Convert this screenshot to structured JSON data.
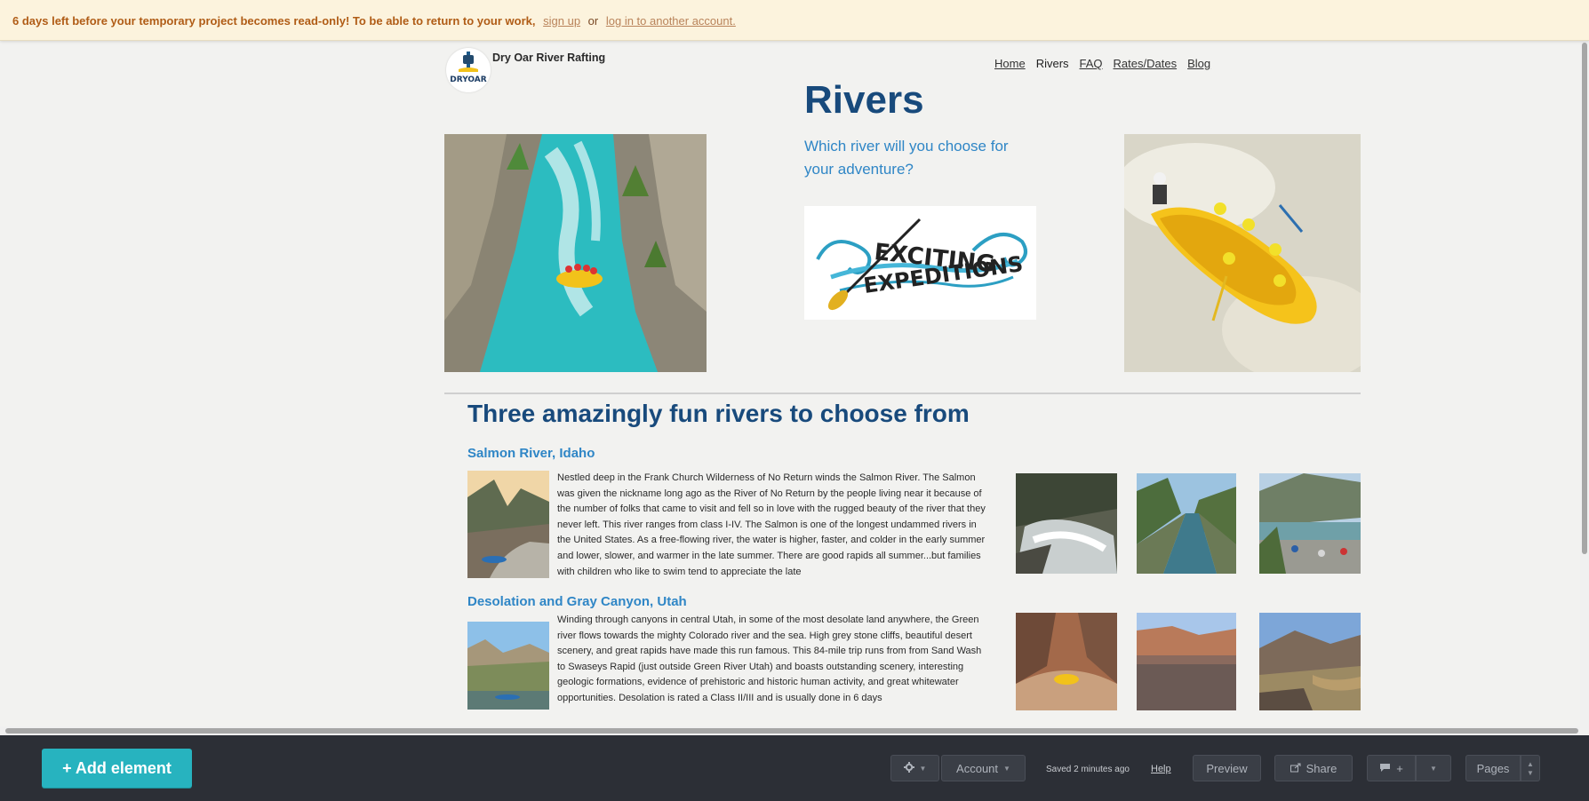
{
  "banner": {
    "message": "6 days left before your temporary project becomes read-only! To be able to return to your work,",
    "signup_link": "sign up",
    "or_text": "or",
    "login_link": "log in to another account."
  },
  "site": {
    "name": "Dry Oar River Rafting",
    "logo_text": "DRYOAR"
  },
  "nav": {
    "items": [
      {
        "label": "Home",
        "active": false
      },
      {
        "label": "Rivers",
        "active": true
      },
      {
        "label": "FAQ",
        "active": false
      },
      {
        "label": "Rates/Dates",
        "active": false
      },
      {
        "label": "Blog",
        "active": false
      }
    ]
  },
  "hero": {
    "title": "Rivers",
    "subtitle": "Which river will you choose for your adventure?",
    "logo_line1": "EXCITING",
    "logo_line2": "EXPEDITIONS"
  },
  "section": {
    "title": "Three amazingly fun rivers to choose from"
  },
  "rivers": [
    {
      "name": "Salmon River, Idaho",
      "description": "Nestled deep in the Frank Church Wilderness of No Return winds the Salmon River. The Salmon was given the nickname long ago as the River of No Return by the people living near it because of the number of folks that came to visit and fell so in love with the rugged beauty of the river that they never left. This river ranges from class I-IV. The Salmon is one of the longest undammed rivers in the United States. As a free-flowing river, the water is higher, faster, and colder in the early summer and lower, slower, and warmer in the late summer. There are good rapids all summer...but families with children who like to swim tend to appreciate the late"
    },
    {
      "name": "Desolation and Gray Canyon, Utah",
      "description": "Winding through canyons in central Utah, in some of the most desolate land anywhere, the Green river flows towards the mighty Colorado river and the sea. High grey stone cliffs, beautiful desert scenery, and great rapids have made this run famous. This 84-mile trip runs from from Sand Wash to Swaseys Rapid (just outside Green River Utah) and boasts outstanding scenery, interesting geologic formations, evidence of prehistoric and historic human activity, and great whitewater opportunities. Desolation is rated a Class II/III and is usually done in 6 days"
    }
  ],
  "toolbar": {
    "add_element": "+ Add element",
    "gear_icon": "gear-icon",
    "account": "Account",
    "saved_status": "Saved 2 minutes ago",
    "help": "Help",
    "preview": "Preview",
    "share": "Share",
    "comment_add": "+",
    "pages": "Pages"
  },
  "colors": {
    "banner_bg": "#fcf3dd",
    "banner_text": "#b05c16",
    "title_navy": "#184a7c",
    "accent_blue": "#2f86c6",
    "toolbar_bg": "#2c2f36",
    "add_button": "#27b3bf"
  }
}
